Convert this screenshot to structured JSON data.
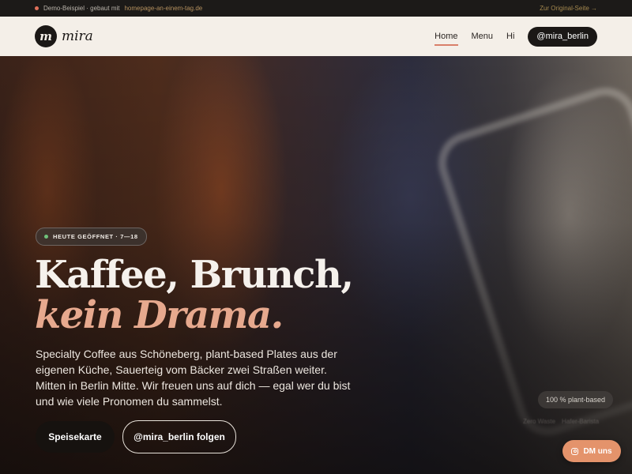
{
  "demo_bar": {
    "text": "Demo-Beispiel · gebaut mit",
    "link": "homepage-an-einem-tag.de",
    "original_link": "Zur Original-Seite →"
  },
  "header": {
    "logo_letter": "m",
    "brand": "mira",
    "nav": [
      {
        "label": "Home",
        "active": true
      },
      {
        "label": "Menu",
        "active": false
      },
      {
        "label": "Hi",
        "active": false
      }
    ],
    "instagram_button": "@mira_berlin"
  },
  "hero": {
    "badge": "HEUTE GEÖFFNET · 7—18",
    "title_line1": "Kaffee, Brunch,",
    "title_line2": "kein Drama.",
    "lead": "Specialty Coffee aus Schöneberg, plant-based Plates aus der eigenen Küche, Sauerteig vom Bäcker zwei Straßen weiter. Mitten in Berlin Mitte. Wir freuen uns auf dich — egal wer du bist und wie viele Pronomen du sammelst.",
    "primary_cta": "Speisekarte",
    "secondary_cta": "@mira_berlin folgen",
    "plant_pill": "100 % plant-based",
    "faint_tags": [
      "Zero Waste",
      "Hafer-Barista"
    ],
    "dm_button": "DM uns"
  },
  "colors": {
    "accent": "#e7a98e",
    "header_bg": "#f4efe8",
    "dm_button": "#e4936b",
    "status_dot": "#6fc27a"
  }
}
